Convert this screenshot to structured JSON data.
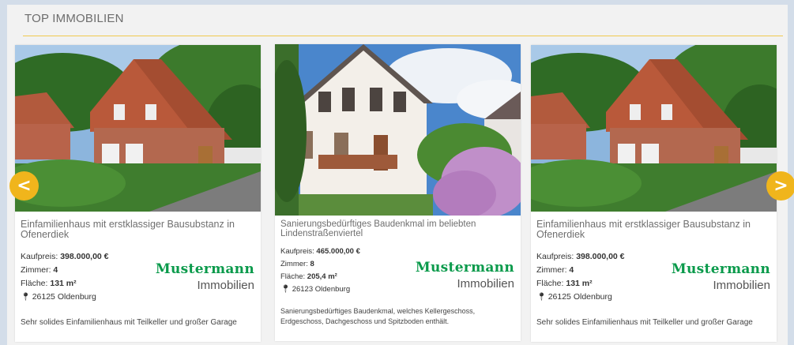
{
  "section": {
    "title": "TOP IMMOBILIEN"
  },
  "nav": {
    "prev": "<",
    "next": ">"
  },
  "colors": {
    "accent": "#f0b51c",
    "brand": "#0a9a4b",
    "rule": "#f0c94f"
  },
  "cards": [
    {
      "title": "Einfamilienhaus mit erstklassiger Bausubstanz in Ofenerdiek",
      "price_label": "Kaufpreis:",
      "price": "398.000,00 €",
      "rooms_label": "Zimmer:",
      "rooms": "4",
      "area_label": "Fläche:",
      "area": "131 m²",
      "location_icon": "map-pin-icon",
      "location": "26125 Oldenburg",
      "brand_name": "Mustermann",
      "brand_sub": "Immobilien",
      "description": "Sehr solides Einfamilienhaus mit Teilkeller und großer Garage"
    },
    {
      "title": "Sanierungsbedürftiges Baudenkmal im beliebten Lindenstraßenviertel",
      "price_label": "Kaufpreis:",
      "price": "465.000,00 €",
      "rooms_label": "Zimmer:",
      "rooms": "8",
      "area_label": "Fläche:",
      "area": "205,4 m²",
      "location_icon": "map-pin-icon",
      "location": "26123 Oldenburg",
      "brand_name": "Mustermann",
      "brand_sub": "Immobilien",
      "description": "Sanierungsbedürftiges Baudenkmal, welches Kellergeschoss, Erdgeschoss, Dachgeschoss und Spitzboden enthält."
    },
    {
      "title": "Einfamilienhaus mit erstklassiger Bausubstanz in Ofenerdiek",
      "price_label": "Kaufpreis:",
      "price": "398.000,00 €",
      "rooms_label": "Zimmer:",
      "rooms": "4",
      "area_label": "Fläche:",
      "area": "131 m²",
      "location_icon": "map-pin-icon",
      "location": "26125 Oldenburg",
      "brand_name": "Mustermann",
      "brand_sub": "Immobilien",
      "description": "Sehr solides Einfamilienhaus mit Teilkeller und großer Garage"
    }
  ]
}
